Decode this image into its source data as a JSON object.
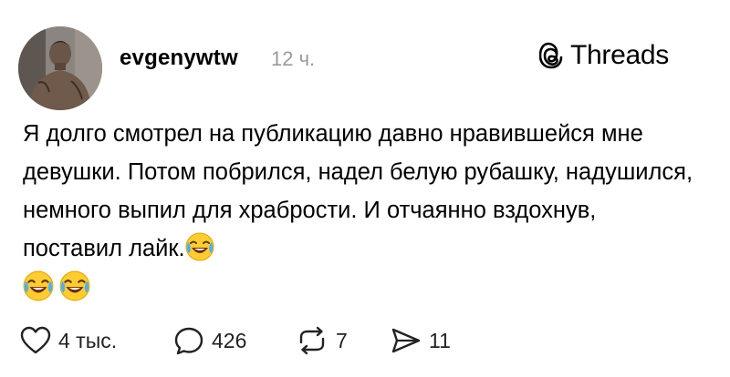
{
  "post": {
    "username": "evgenywtw",
    "time": "12 ч.",
    "brand": "Threads",
    "text": "Я долго смотрел на публикацию давно нравившейся мне девушки. Потом побрился, надел белую рубашку, надушился, немного выпил для храбрости. И отчаянно вздохнув, поставил лайк.",
    "emoji": "face-with-tears-of-joy"
  },
  "actions": {
    "likes": "4 тыс.",
    "comments": "426",
    "reposts": "7",
    "shares": "11"
  },
  "icons": {
    "avatar": "profile-photo",
    "brand": "threads-logo",
    "like": "heart-icon",
    "comment": "comment-bubble-icon",
    "repost": "repost-arrows-icon",
    "share": "send-arrow-icon"
  }
}
